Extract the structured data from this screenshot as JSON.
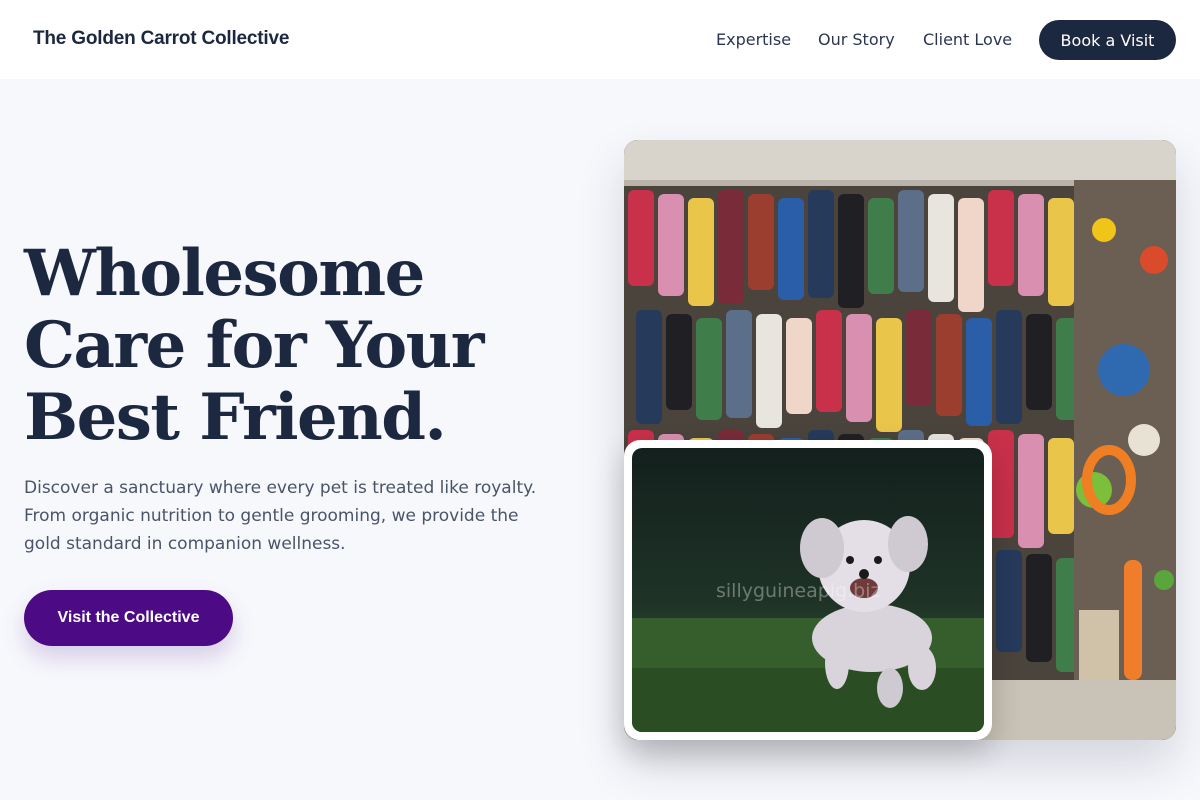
{
  "header": {
    "brand": "The Golden Carrot Collective",
    "nav": [
      {
        "label": "Expertise"
      },
      {
        "label": "Our Story"
      },
      {
        "label": "Client Love"
      }
    ],
    "book_label": "Book a Visit"
  },
  "hero": {
    "title_lines": [
      "Wholesome",
      "Care for Your",
      "Best Friend."
    ],
    "subtitle_lines": [
      "Discover a sanctuary where every pet is treated like royalty.",
      "From organic nutrition to gentle grooming, we provide the",
      "gold standard in companion wellness."
    ],
    "cta_label": "Visit the Collective"
  },
  "images": {
    "store_photo": "pet-store-apparel-wall",
    "dog_photo": "running-white-puppy",
    "watermark": "sillyguineapig.biz"
  },
  "colors": {
    "navy": "#1c2740",
    "purple": "#4c0b85",
    "background": "#f7f8fc"
  }
}
